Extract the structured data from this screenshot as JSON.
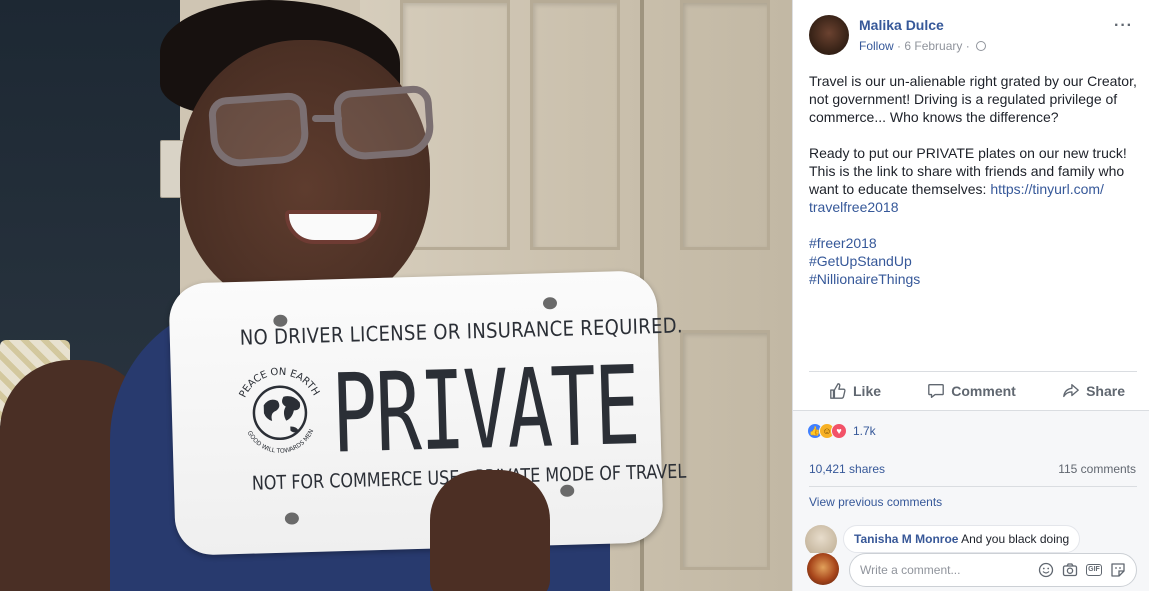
{
  "post": {
    "author": "Malika Dulce",
    "follow_label": "Follow",
    "separator": "·",
    "date": "6 February",
    "more_label": "···",
    "paragraph1": "Travel is our un-alienable right grated by our Creator, not government! Driving is a regulated privilege of commerce... Who knows the difference?",
    "paragraph2_text": "Ready to put our PRIVATE plates on our new truck! This is the link to share with friends and family who want to educate themselves: ",
    "link_line1": "https://tinyurl.com/",
    "link_line2": "travelfree2018",
    "hashtags": [
      "#freer2018",
      "#GetUpStandUp",
      "#NillionaireThings"
    ]
  },
  "plate": {
    "top_text": "NO DRIVER LICENSE OR INSURANCE REQUIRED.",
    "main_text": "PRIVATE",
    "bottom_text": "NOT FOR COMMERCE USE - PRIVATE MODE OF TRAVEL",
    "seal_top": "PEACE ON EARTH",
    "seal_bottom": "GOOD WILL TOWARDS MEN"
  },
  "actions": {
    "like": "Like",
    "comment": "Comment",
    "share": "Share"
  },
  "feedback": {
    "reaction_count": "1.7k",
    "shares": "10,421 shares",
    "comments": "115 comments",
    "view_previous": "View previous comments"
  },
  "comment": {
    "author": "Tanisha M Monroe",
    "text": "And you black doing"
  },
  "composer": {
    "placeholder": "Write a comment...",
    "gif_label": "GIF"
  },
  "colors": {
    "link": "#365899",
    "meta": "#90949c",
    "text": "#1d2129",
    "like_reaction": "#4080ff",
    "haha_reaction": "#f7b125",
    "love_reaction": "#f25268"
  }
}
